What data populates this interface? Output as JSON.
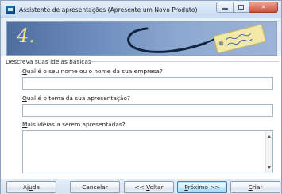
{
  "window": {
    "title": "Assistente de apresentações (Apresente um Novo Produto)"
  },
  "banner": {
    "step_number": "4."
  },
  "group": {
    "label": "Descreva suas ideias básicas"
  },
  "fields": [
    {
      "mnemonic": "Q",
      "label_rest": "ual é o seu nome ou o nome da sua empresa?",
      "value": ""
    },
    {
      "mnemonic": "Q",
      "label_rest": "ual é o tema da sua apresentação?",
      "value": ""
    },
    {
      "mnemonic": "M",
      "label_rest": "ais ideias a serem apresentadas?",
      "value": ""
    }
  ],
  "buttons": {
    "help": {
      "mnemonic": "u",
      "before": "Aj",
      "after": "da"
    },
    "cancel": {
      "label": "Cancelar"
    },
    "back": {
      "before": "<< ",
      "mnemonic": "V",
      "after": "oltar"
    },
    "next": {
      "mnemonic": "P",
      "after": "róximo >>"
    },
    "create": {
      "mnemonic": "C",
      "after": "riar"
    }
  },
  "colors": {
    "banner_accent": "#f4e08a",
    "primary_button": "#a7d9f5",
    "close_button": "#c9523c"
  }
}
